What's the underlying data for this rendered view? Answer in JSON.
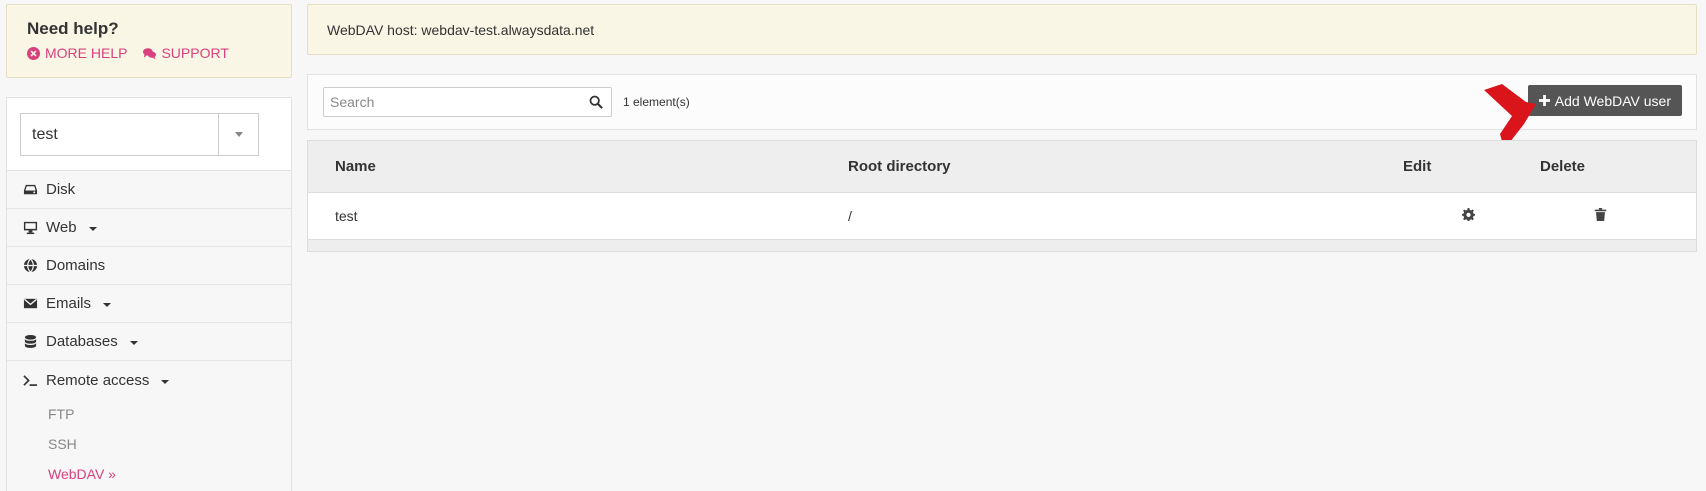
{
  "help": {
    "title": "Need help?",
    "more_help_label": "MORE HELP",
    "support_label": "SUPPORT"
  },
  "account_selector": {
    "value": "test"
  },
  "nav": {
    "disk": "Disk",
    "web": "Web",
    "domains": "Domains",
    "emails": "Emails",
    "databases": "Databases",
    "remote_access": "Remote access",
    "sub_items": {
      "ftp": "FTP",
      "ssh": "SSH",
      "webdav": "WebDAV »"
    }
  },
  "info": {
    "text": "WebDAV host: webdav-test.alwaysdata.net"
  },
  "toolbar": {
    "search_placeholder": "Search",
    "count_text": "1 element(s)",
    "add_button_label": "Add WebDAV user"
  },
  "table": {
    "headers": {
      "name": "Name",
      "root": "Root directory",
      "edit": "Edit",
      "delete": "Delete"
    },
    "rows": [
      {
        "name": "test",
        "root": "/"
      }
    ]
  },
  "colors": {
    "accent": "#d9417e",
    "button_bg": "#555555",
    "info_bg": "#faf6e5",
    "arrow": "#d9141b"
  },
  "icons": [
    "times-circle-icon",
    "comments-icon",
    "hdd-icon",
    "desktop-icon",
    "globe-icon",
    "envelope-icon",
    "database-icon",
    "terminal-icon",
    "search-icon",
    "plus-icon",
    "gear-icon",
    "trash-icon"
  ]
}
